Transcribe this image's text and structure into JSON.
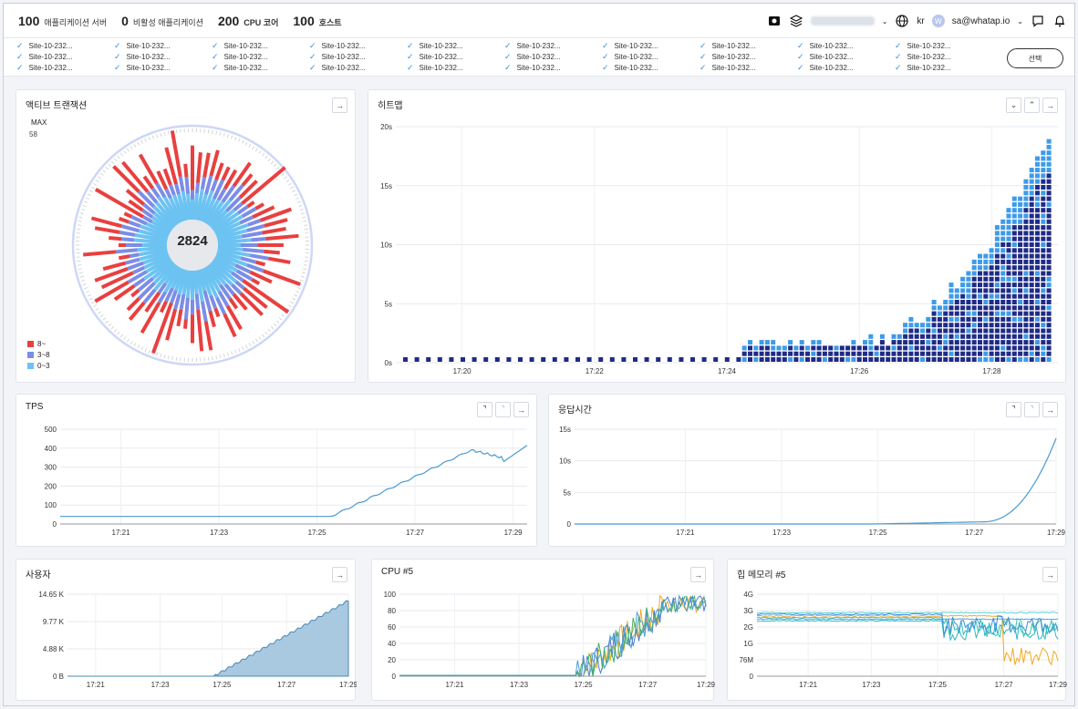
{
  "header": {
    "stats": [
      {
        "num": "100",
        "label": "애플리케이션 서버",
        "bold": false
      },
      {
        "num": "0",
        "label": "비활성 애플리케이션",
        "bold": false
      },
      {
        "num": "200",
        "label": "CPU 코어",
        "bold": true
      },
      {
        "num": "100",
        "label": "호스트",
        "bold": true
      }
    ],
    "language": "kr",
    "user": "sa@whatap.io",
    "avatar_letter": "W",
    "icons": [
      "camera-icon",
      "layers-icon",
      "globe-icon",
      "message-icon",
      "bell-icon"
    ]
  },
  "agents": {
    "label": "Site-10-232...",
    "columns": 10,
    "rows": 3,
    "select_label": "선택"
  },
  "colors": {
    "red": "#e8403f",
    "mid": "#7b8de6",
    "light": "#6cc3f2",
    "navy": "#1f2b86",
    "heat_light": "#3d9be9",
    "line": "#4a9bd1"
  },
  "active_tx": {
    "title": "액티브 트랜잭션",
    "max_label": "MAX",
    "max_value": "58",
    "total": "2824",
    "legend": [
      {
        "label": "8~",
        "color": "#e8403f"
      },
      {
        "label": "3~8",
        "color": "#7b8de6"
      },
      {
        "label": "0~3",
        "color": "#6cc3f2"
      }
    ]
  },
  "heatmap": {
    "title": "히트맵",
    "y_ticks": [
      "20s",
      "15s",
      "10s",
      "5s",
      "0s"
    ],
    "x_ticks": [
      "17:20",
      "17:22",
      "17:24",
      "17:26",
      "17:28"
    ]
  },
  "tps": {
    "title": "TPS",
    "y_ticks": [
      "500",
      "400",
      "300",
      "200",
      "100",
      "0"
    ],
    "x_ticks": [
      "17:21",
      "17:23",
      "17:25",
      "17:27",
      "17:29"
    ]
  },
  "resp": {
    "title": "응답시간",
    "y_ticks": [
      "15s",
      "10s",
      "5s",
      "0"
    ],
    "x_ticks": [
      "17:21",
      "17:23",
      "17:25",
      "17:27",
      "17:29"
    ]
  },
  "users": {
    "title": "사용자",
    "y_ticks": [
      "14.65 K",
      "9.77 K",
      "4.88 K",
      "0 B"
    ],
    "x_ticks": [
      "17:21",
      "17:23",
      "17:25",
      "17:27",
      "17:29"
    ]
  },
  "cpu": {
    "title": "CPU #5",
    "y_ticks": [
      "100",
      "80",
      "60",
      "40",
      "20",
      "0"
    ],
    "x_ticks": [
      "17:21",
      "17:23",
      "17:25",
      "17:27",
      "17:29"
    ]
  },
  "heap": {
    "title": "힙 메모리 #5",
    "y_ticks": [
      "4G",
      "3G",
      "2G",
      "1G",
      "76M",
      "0"
    ],
    "x_ticks": [
      "17:21",
      "17:23",
      "17:25",
      "17:27",
      "17:29"
    ]
  },
  "chart_data": [
    {
      "type": "line",
      "title": "TPS",
      "x": [
        "17:20",
        "17:21",
        "17:22",
        "17:23",
        "17:24",
        "17:25",
        "17:26",
        "17:27",
        "17:28",
        "17:29"
      ],
      "values": [
        40,
        40,
        40,
        40,
        40,
        40,
        160,
        290,
        390,
        410
      ],
      "ylim": [
        0,
        500
      ]
    },
    {
      "type": "line",
      "title": "응답시간",
      "x": [
        "17:20",
        "17:21",
        "17:22",
        "17:23",
        "17:24",
        "17:25",
        "17:26",
        "17:27",
        "17:28",
        "17:29"
      ],
      "values": [
        0,
        0,
        0,
        0,
        0,
        0.2,
        0.4,
        0.6,
        2.5,
        13.5
      ],
      "ylim": [
        0,
        15
      ]
    },
    {
      "type": "area",
      "title": "사용자",
      "x": [
        "17:20",
        "17:21",
        "17:22",
        "17:23",
        "17:24",
        "17:25",
        "17:26",
        "17:27",
        "17:28",
        "17:29"
      ],
      "values": [
        0,
        0,
        0,
        0,
        0,
        0,
        4000,
        8000,
        11500,
        13500
      ],
      "ylim": [
        0,
        14650
      ]
    },
    {
      "type": "line",
      "title": "CPU #5",
      "x": [
        "17:20",
        "17:21",
        "17:22",
        "17:23",
        "17:24",
        "17:25",
        "17:26",
        "17:27",
        "17:28",
        "17:29"
      ],
      "values": [
        1,
        1,
        1,
        1,
        1,
        2,
        50,
        75,
        95,
        90
      ],
      "ylim": [
        0,
        100
      ]
    },
    {
      "type": "line",
      "title": "힙 메모리 #5",
      "x": [
        "17:20",
        "17:21",
        "17:22",
        "17:23",
        "17:24",
        "17:25",
        "17:26",
        "17:27",
        "17:28",
        "17:29"
      ],
      "values": [
        3.0,
        3.0,
        3.0,
        3.0,
        3.0,
        3.0,
        2.5,
        2.2,
        1.8,
        2.0
      ],
      "ylim": [
        0,
        4
      ]
    }
  ]
}
